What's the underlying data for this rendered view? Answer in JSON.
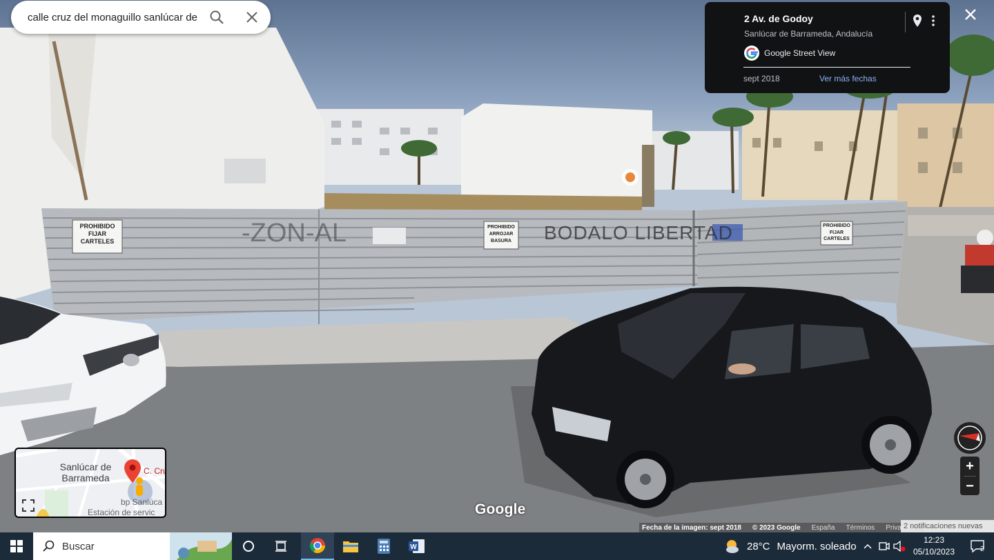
{
  "search": {
    "value": "calle cruz del monaguillo sanlúcar de"
  },
  "info_card": {
    "title": "2 Av. de Godoy",
    "subtitle": "Sanlúcar de Barrameda, Andalucía",
    "service": "Google Street View",
    "date": "sept 2018",
    "more_dates": "Ver más fechas"
  },
  "signs": {
    "left": [
      "PROHIBIDO",
      "FIJAR",
      "CARTELES"
    ],
    "center": [
      "PROHIBIDO",
      "ARROJAR",
      "BASURA"
    ],
    "right": [
      "PROHIBIDO",
      "FIJAR",
      "CARTELES"
    ],
    "graffiti": "BODALO LIBERTAD"
  },
  "minimap": {
    "city_line1": "Sanlúcar de",
    "city_line2": "Barrameda",
    "street": "C. Cru",
    "poi_line1": "bp Sanlúca",
    "poi_line2": "Estación de servic"
  },
  "watermark": "Google",
  "footer": {
    "image_date": "Fecha de la imagen: sept 2018",
    "copyright": "© 2023 Google",
    "country": "España",
    "terms": "Términos",
    "privacy": "Privacid"
  },
  "notification_tip": "2 notificaciones nuevas",
  "taskbar": {
    "search_label": "Buscar",
    "weather_temp": "28°C",
    "weather_desc": "Mayorm. soleado",
    "time": "12:23",
    "date": "05/10/2023",
    "notif_count": "2"
  },
  "colors": {
    "sky": "#8ba0bd",
    "fence": "#b7bbbf",
    "car_black": "#16181c",
    "car_white": "#f3f4f5",
    "taskbar": "#1c2b3a",
    "link": "#8ab4f8"
  }
}
